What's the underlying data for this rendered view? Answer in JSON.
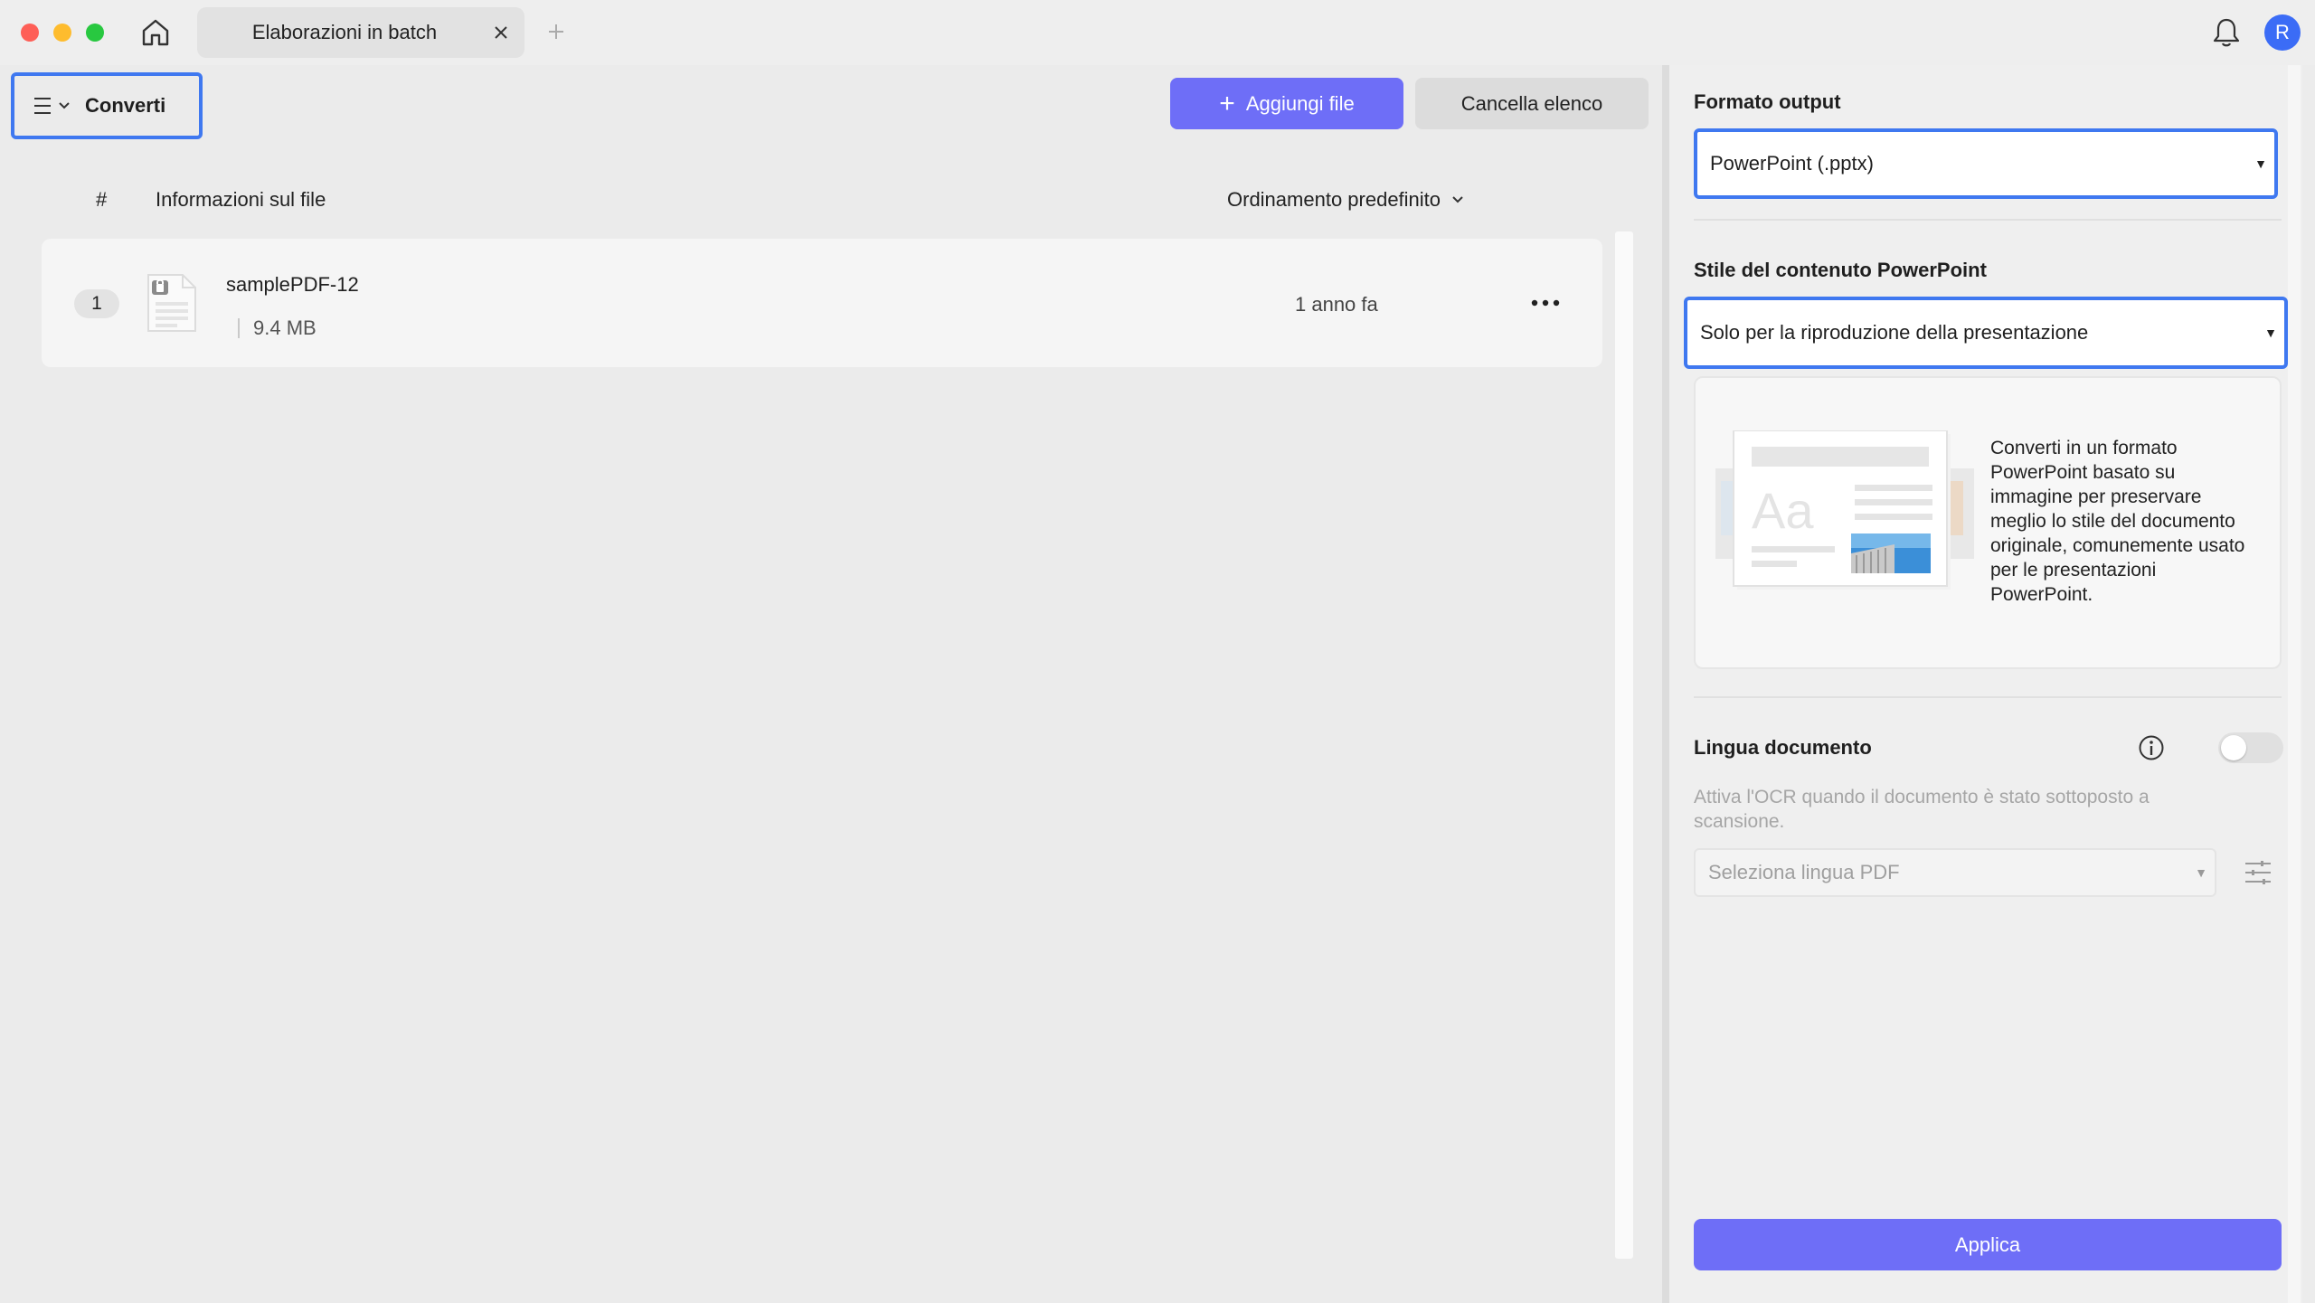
{
  "tabbar": {
    "tab_title": "Elaborazioni in batch",
    "avatar_initial": "R"
  },
  "left": {
    "mode_label": "Converti",
    "add_files_label": "Aggiungi file",
    "clear_list_label": "Cancella elenco",
    "columns": {
      "index": "#",
      "file_info": "Informazioni sul file",
      "sort": "Ordinamento predefinito"
    },
    "files": [
      {
        "index": "1",
        "name": "samplePDF-12",
        "size": "9.4 MB",
        "time": "1 anno fa"
      }
    ]
  },
  "right": {
    "output_format_title": "Formato output",
    "output_format_value": "PowerPoint (.pptx)",
    "content_style_title": "Stile del contenuto PowerPoint",
    "content_style_value": "Solo per la riproduzione della presentazione",
    "preview_description": "Converti in un formato PowerPoint basato su immagine per preservare meglio lo stile del documento originale, comunemente usato per le presentazioni PowerPoint.",
    "doc_language_title": "Lingua documento",
    "ocr_enabled": false,
    "ocr_hint": "Attiva l'OCR quando il documento è stato sottoposto a scansione.",
    "language_placeholder": "Seleziona lingua PDF",
    "apply_label": "Applica"
  },
  "colors": {
    "accent": "#6e6ef7",
    "highlight_border": "#3f78f0",
    "avatar": "#3b6cf6"
  }
}
